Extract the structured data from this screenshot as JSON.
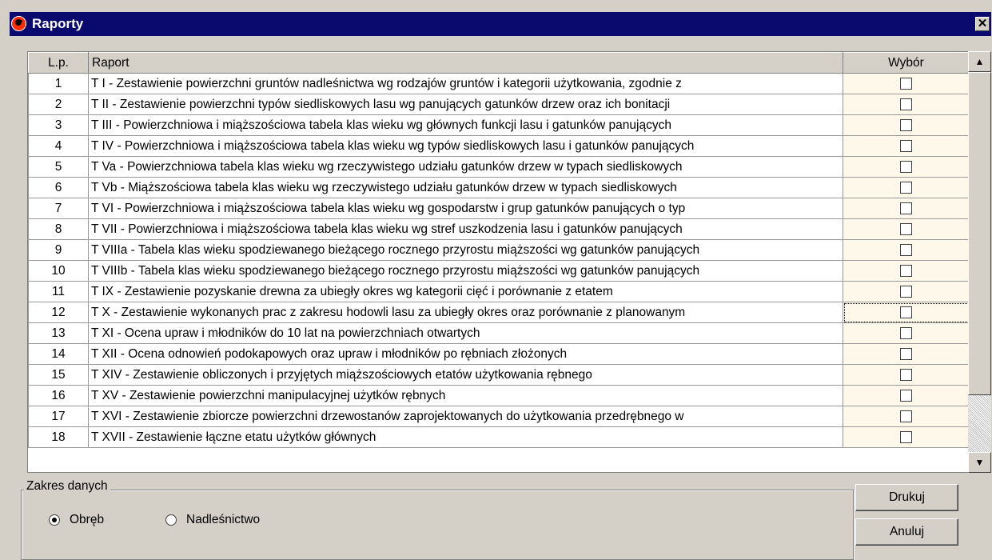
{
  "window": {
    "title": "Raporty",
    "close_glyph": "✕"
  },
  "table": {
    "headers": {
      "lp": "L.p.",
      "raport": "Raport",
      "wybor": "Wybór"
    },
    "rows": [
      {
        "lp": "1",
        "raport": "T I - Zestawienie powierzchni gruntów nadleśnictwa wg rodzajów gruntów i kategorii użytkowania, zgodnie z",
        "checked": false
      },
      {
        "lp": "2",
        "raport": "T II - Zestawienie powierzchni typów siedliskowych lasu wg panujących gatunków drzew oraz ich bonitacji",
        "checked": false
      },
      {
        "lp": "3",
        "raport": "T III - Powierzchniowa i miąższościowa tabela klas wieku wg głównych funkcji lasu i gatunków panujących",
        "checked": false
      },
      {
        "lp": "4",
        "raport": "T IV - Powierzchniowa i miąższościowa tabela klas wieku wg typów siedliskowych lasu i gatunków panujących",
        "checked": false
      },
      {
        "lp": "5",
        "raport": "T Va - Powierzchniowa tabela klas wieku wg rzeczywistego udziału gatunków drzew w typach siedliskowych",
        "checked": false
      },
      {
        "lp": "6",
        "raport": "T Vb - Miąższościowa tabela klas wieku wg rzeczywistego udziału gatunków drzew w typach siedliskowych",
        "checked": false
      },
      {
        "lp": "7",
        "raport": "T VI - Powierzchniowa i miąższościowa tabela klas wieku wg gospodarstw i grup gatunków panujących o typ",
        "checked": false
      },
      {
        "lp": "8",
        "raport": "T VII - Powierzchniowa i miąższościowa tabela klas wieku wg stref uszkodzenia lasu i gatunków panujących",
        "checked": false
      },
      {
        "lp": "9",
        "raport": "T VIIIa - Tabela klas wieku spodziewanego bieżącego rocznego przyrostu miąższości wg gatunków panujących",
        "checked": false
      },
      {
        "lp": "10",
        "raport": "T VIIIb - Tabela klas wieku spodziewanego bieżącego rocznego przyrostu miąższości wg gatunków panujących",
        "checked": false
      },
      {
        "lp": "11",
        "raport": "T IX - Zestawienie pozyskanie drewna za ubiegły okres wg kategorii cięć i porównanie z etatem",
        "checked": false
      },
      {
        "lp": "12",
        "raport": "T X - Zestawienie wykonanych prac z zakresu hodowli lasu za ubiegły okres oraz porównanie z planowanym",
        "checked": false,
        "focused": true
      },
      {
        "lp": "13",
        "raport": "T XI - Ocena upraw i młodników do 10 lat na powierzchniach otwartych",
        "checked": false
      },
      {
        "lp": "14",
        "raport": "T XII - Ocena odnowień podokapowych oraz upraw i młodników po rębniach złożonych",
        "checked": false
      },
      {
        "lp": "15",
        "raport": "T XIV - Zestawienie obliczonych i przyjętych miąższościowych etatów użytkowania rębnego",
        "checked": false
      },
      {
        "lp": "16",
        "raport": "T XV - Zestawienie powierzchni manipulacyjnej użytków rębnych",
        "checked": false
      },
      {
        "lp": "17",
        "raport": "T XVI - Zestawienie zbiorcze powierzchni drzewostanów zaprojektowanych do użytkowania przedrębnego w",
        "checked": false
      },
      {
        "lp": "18",
        "raport": "T XVII - Zestawienie łączne etatu użytków głównych",
        "checked": false
      }
    ]
  },
  "scrollbar": {
    "up_glyph": "▲",
    "down_glyph": "▼"
  },
  "zakres": {
    "label": "Zakres danych",
    "options": [
      {
        "label": "Obręb",
        "selected": true
      },
      {
        "label": "Nadleśnictwo",
        "selected": false
      }
    ]
  },
  "buttons": {
    "print": "Drukuj",
    "cancel": "Anuluj"
  }
}
